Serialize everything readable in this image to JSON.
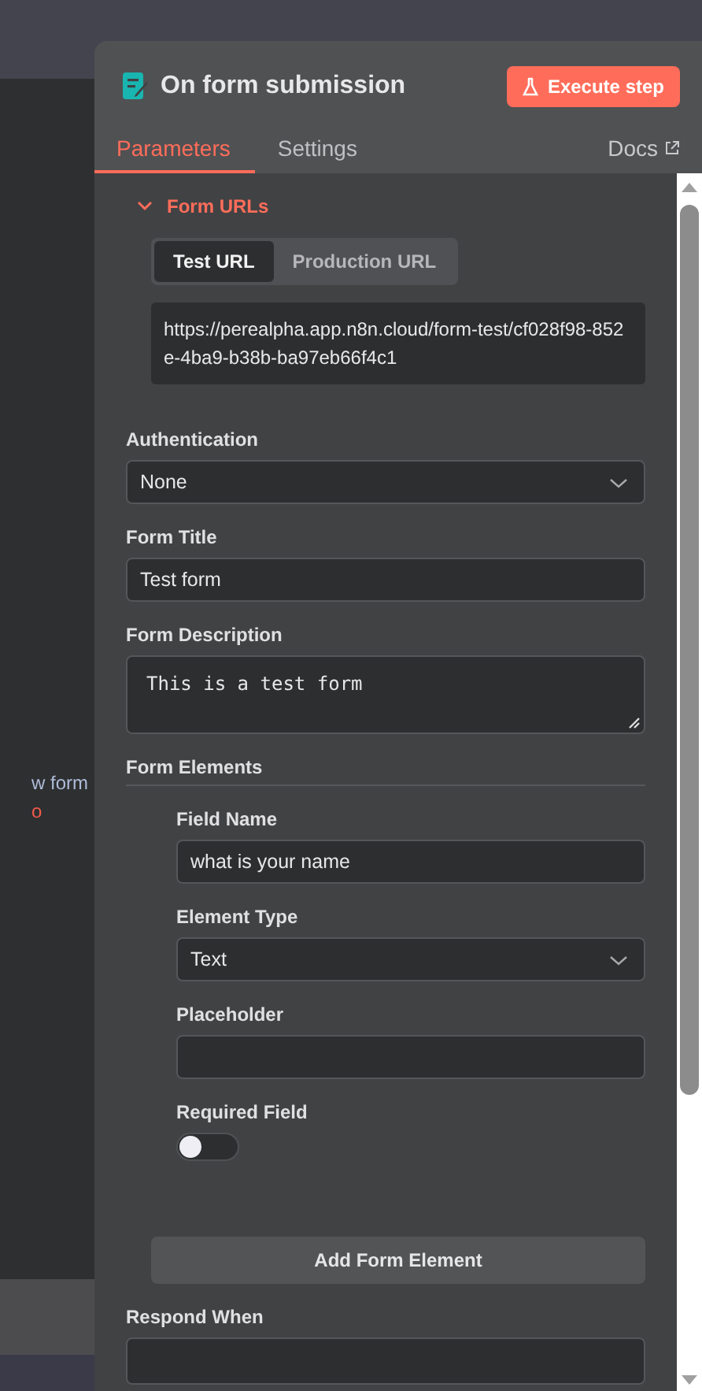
{
  "canvas": {
    "texts": [
      {
        "text": "w form",
        "kind": "note"
      },
      {
        "text": "o",
        "kind": "link"
      }
    ]
  },
  "panel": {
    "title": "On form submission",
    "execute_button": "Execute step",
    "tabs": [
      {
        "label": "Parameters",
        "selected": true
      },
      {
        "label": "Settings",
        "selected": false
      }
    ],
    "docs_link": "Docs",
    "form_urls": {
      "title": "Form URLs",
      "expanded": true,
      "toggle": [
        {
          "label": "Test URL",
          "selected": true
        },
        {
          "label": "Production URL",
          "selected": false
        }
      ],
      "url": "https://perealpha.app.n8n.cloud/form-test/cf028f98-852e-4ba9-b38b-ba97eb66f4c1"
    },
    "authentication": {
      "label": "Authentication",
      "value": "None"
    },
    "form_title": {
      "label": "Form Title",
      "value": "Test form"
    },
    "form_description": {
      "label": "Form Description",
      "value": "This is a test form"
    },
    "form_elements": {
      "label": "Form Elements",
      "field_name": {
        "label": "Field Name",
        "value": "what is your name"
      },
      "element_type": {
        "label": "Element Type",
        "value": "Text"
      },
      "placeholder": {
        "label": "Placeholder"
      },
      "required_field": {
        "label": "Required Field",
        "on": false
      },
      "add_button": "Add Form Element"
    },
    "respond_when": {
      "label": "Respond When"
    }
  }
}
